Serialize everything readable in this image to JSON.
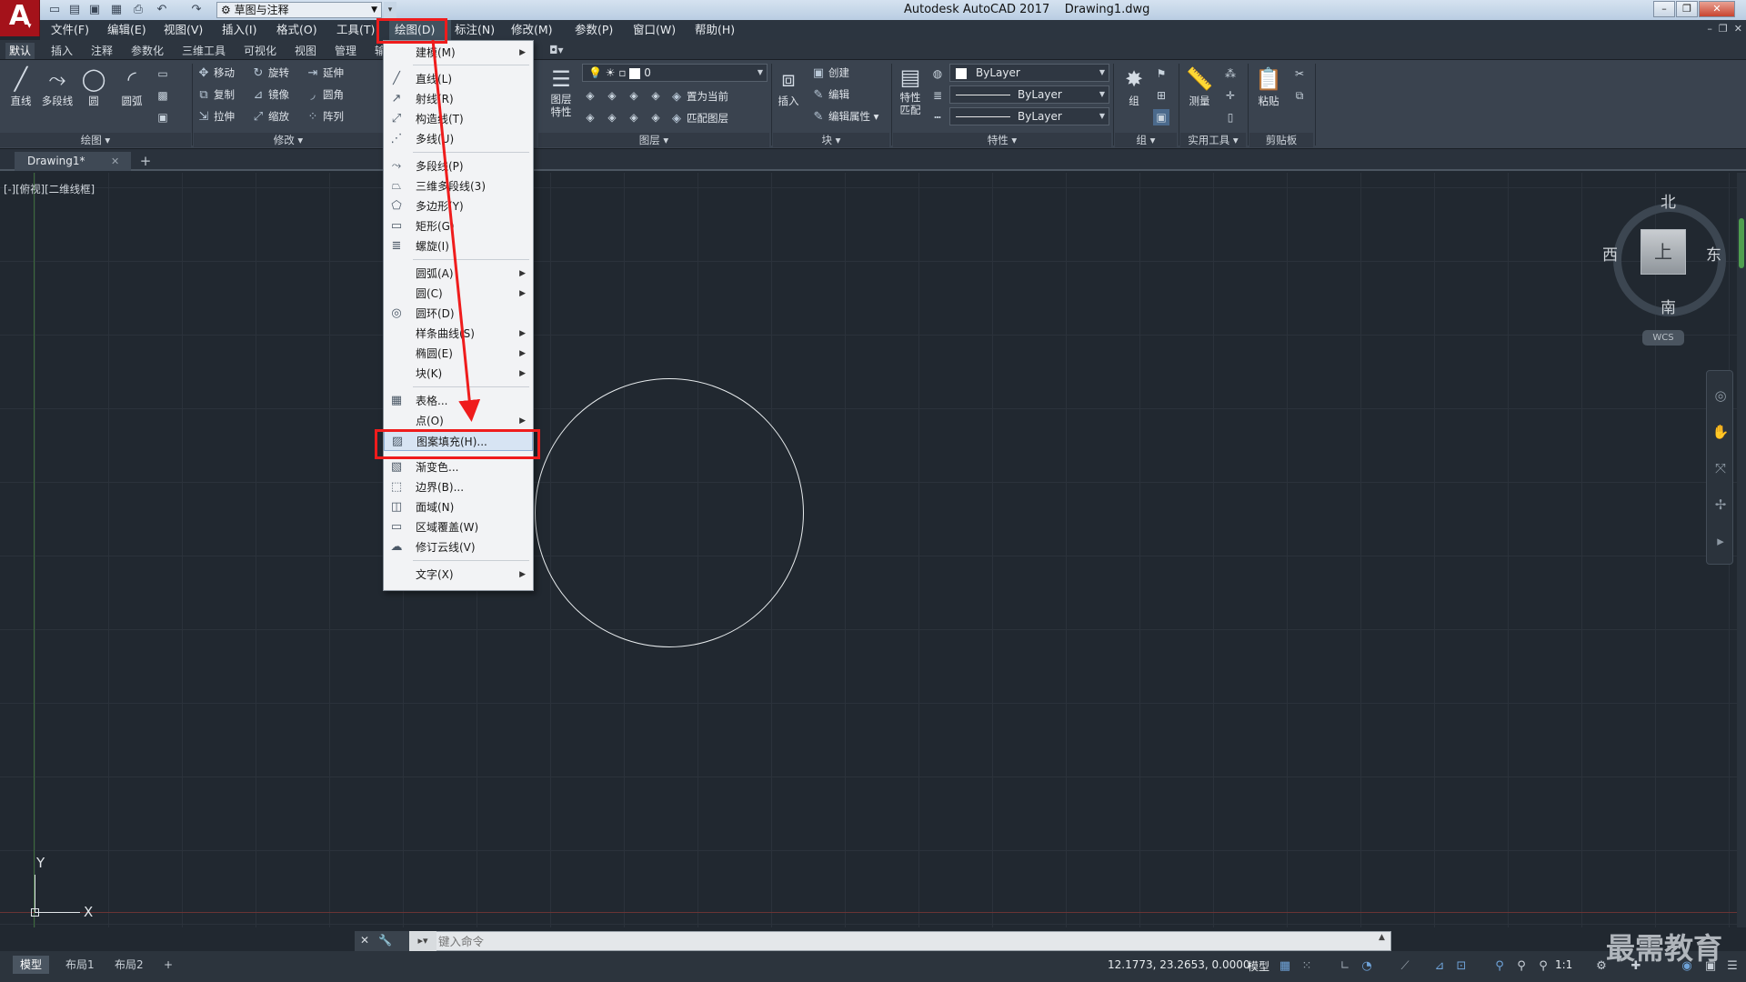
{
  "app": {
    "logo": "A",
    "title": "Autodesk AutoCAD 2017",
    "file": "Drawing1.dwg"
  },
  "quick_access": {
    "workspace": "草图与注释"
  },
  "menubar": [
    "文件(F)",
    "编辑(E)",
    "视图(V)",
    "插入(I)",
    "格式(O)",
    "工具(T)",
    "绘图(D)",
    "标注(N)",
    "修改(M)",
    "参数(P)",
    "窗口(W)",
    "帮助(H)"
  ],
  "ribbon_tabs": [
    "默认",
    "插入",
    "注释",
    "参数化",
    "三维工具",
    "可视化",
    "视图",
    "管理",
    "输"
  ],
  "ribbon": {
    "draw": {
      "title": "绘图",
      "line": "直线",
      "polyline": "多段线",
      "circle": "圆",
      "arc": "圆弧"
    },
    "modify": {
      "title": "修改",
      "move": "移动",
      "rotate": "旋转",
      "extend": "延伸",
      "copy": "复制",
      "mirror": "镜像",
      "fillet": "圆角",
      "stretch": "拉伸",
      "scale": "缩放",
      "array": "阵列"
    },
    "layers": {
      "title": "图层",
      "props": "图层\n特性",
      "current_layer": "0",
      "set_current": "置为当前",
      "match_layer": "匹配图层"
    },
    "block": {
      "title": "块",
      "insert": "插入",
      "create": "创建",
      "edit": "编辑",
      "edit_attr": "编辑属性"
    },
    "properties": {
      "title": "特性",
      "match": "特性\n匹配",
      "color": "ByLayer",
      "linetype": "ByLayer",
      "lineweight": "ByLayer"
    },
    "groups": {
      "title": "组",
      "group": "组"
    },
    "utilities": {
      "title": "实用工具",
      "measure": "测量"
    },
    "clipboard": {
      "title": "剪贴板",
      "paste": "粘贴"
    }
  },
  "doc_tab": {
    "name": "Drawing1*"
  },
  "viewport": {
    "label": "[-][俯视][二维线框]",
    "axis_x": "X",
    "axis_y": "Y"
  },
  "viewcube": {
    "north": "北",
    "south": "南",
    "east": "东",
    "west": "西",
    "face": "上",
    "wcs": "WCS"
  },
  "draw_menu": [
    {
      "label": "建模(M)",
      "submenu": true,
      "icon": ""
    },
    {
      "label": "直线(L)",
      "icon": "line-icon"
    },
    {
      "label": "射线(R)",
      "icon": "ray-icon"
    },
    {
      "label": "构造线(T)",
      "icon": "xline-icon"
    },
    {
      "label": "多线(U)",
      "icon": "mline-icon"
    },
    {
      "label": "多段线(P)",
      "icon": "polyline-icon"
    },
    {
      "label": "三维多段线(3)",
      "icon": "3dpoly-icon"
    },
    {
      "label": "多边形(Y)",
      "icon": "polygon-icon"
    },
    {
      "label": "矩形(G)",
      "icon": "rectangle-icon"
    },
    {
      "label": "螺旋(I)",
      "icon": "helix-icon"
    },
    {
      "label": "圆弧(A)",
      "submenu": true,
      "icon": ""
    },
    {
      "label": "圆(C)",
      "submenu": true,
      "icon": ""
    },
    {
      "label": "圆环(D)",
      "icon": "donut-icon"
    },
    {
      "label": "样条曲线(S)",
      "submenu": true,
      "icon": ""
    },
    {
      "label": "椭圆(E)",
      "submenu": true,
      "icon": ""
    },
    {
      "label": "块(K)",
      "submenu": true,
      "icon": ""
    },
    {
      "label": "表格...",
      "icon": "table-icon"
    },
    {
      "label": "点(O)",
      "submenu": true,
      "icon": ""
    },
    {
      "label": "图案填充(H)...",
      "icon": "hatch-icon",
      "highlighted": true
    },
    {
      "label": "渐变色...",
      "icon": "gradient-icon"
    },
    {
      "label": "边界(B)...",
      "icon": "boundary-icon"
    },
    {
      "label": "面域(N)",
      "icon": "region-icon"
    },
    {
      "label": "区域覆盖(W)",
      "icon": "wipeout-icon"
    },
    {
      "label": "修订云线(V)",
      "icon": "revcloud-icon"
    },
    {
      "label": "文字(X)",
      "submenu": true,
      "icon": ""
    }
  ],
  "command_line": {
    "placeholder": "键入命令"
  },
  "layout_tabs": [
    "模型",
    "布局1",
    "布局2"
  ],
  "status": {
    "coords": "12.1773, 23.2653, 0.0000",
    "model": "模型",
    "scale": "1:1"
  },
  "watermark": "最需教育",
  "colors": {
    "annotation": "#ef1c1c",
    "canvas": "#212830",
    "logo": "#a4121a"
  }
}
